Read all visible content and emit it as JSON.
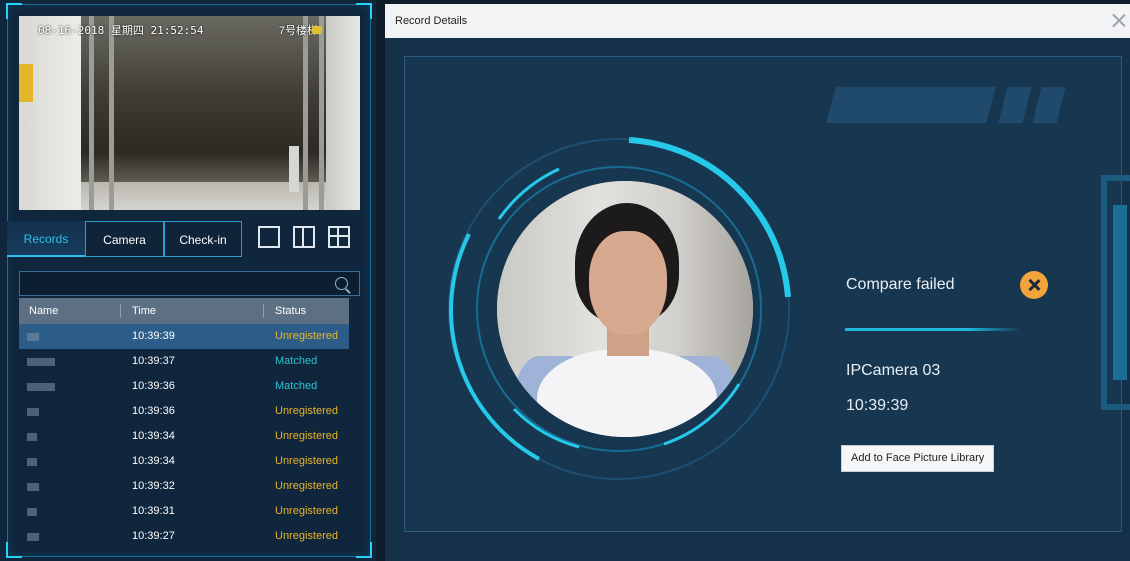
{
  "live_view": {
    "osd_datetime": "08-16-2018 星期四 21:52:54",
    "osd_channel": "7号楼梯"
  },
  "tabs": [
    {
      "label": "Records",
      "active": true
    },
    {
      "label": "Camera",
      "active": false
    },
    {
      "label": "Check-in",
      "active": false
    }
  ],
  "layout_buttons": [
    "single-view-icon",
    "dual-view-icon",
    "quad-view-icon"
  ],
  "search": {
    "placeholder": ""
  },
  "table": {
    "headers": [
      "Name",
      "Time",
      "Status"
    ],
    "rows": [
      {
        "time": "10:39:39",
        "status": "Unregistered",
        "selected": true
      },
      {
        "time": "10:39:37",
        "status": "Matched",
        "selected": false
      },
      {
        "time": "10:39:36",
        "status": "Matched",
        "selected": false
      },
      {
        "time": "10:39:36",
        "status": "Unregistered",
        "selected": false
      },
      {
        "time": "10:39:34",
        "status": "Unregistered",
        "selected": false
      },
      {
        "time": "10:39:34",
        "status": "Unregistered",
        "selected": false
      },
      {
        "time": "10:39:32",
        "status": "Unregistered",
        "selected": false
      },
      {
        "time": "10:39:31",
        "status": "Unregistered",
        "selected": false
      },
      {
        "time": "10:39:27",
        "status": "Unregistered",
        "selected": false
      }
    ]
  },
  "dialog": {
    "title": "Record Details",
    "result": "Compare failed",
    "result_icon": "fail-x-icon",
    "camera": "IPCamera 03",
    "time": "10:39:39",
    "add_button": "Add to Face Picture Library"
  },
  "colors": {
    "accent": "#2ec0e8",
    "unregistered": "#e6b32c",
    "matched": "#2fc1cf",
    "fail_icon": "#f2a33a"
  }
}
